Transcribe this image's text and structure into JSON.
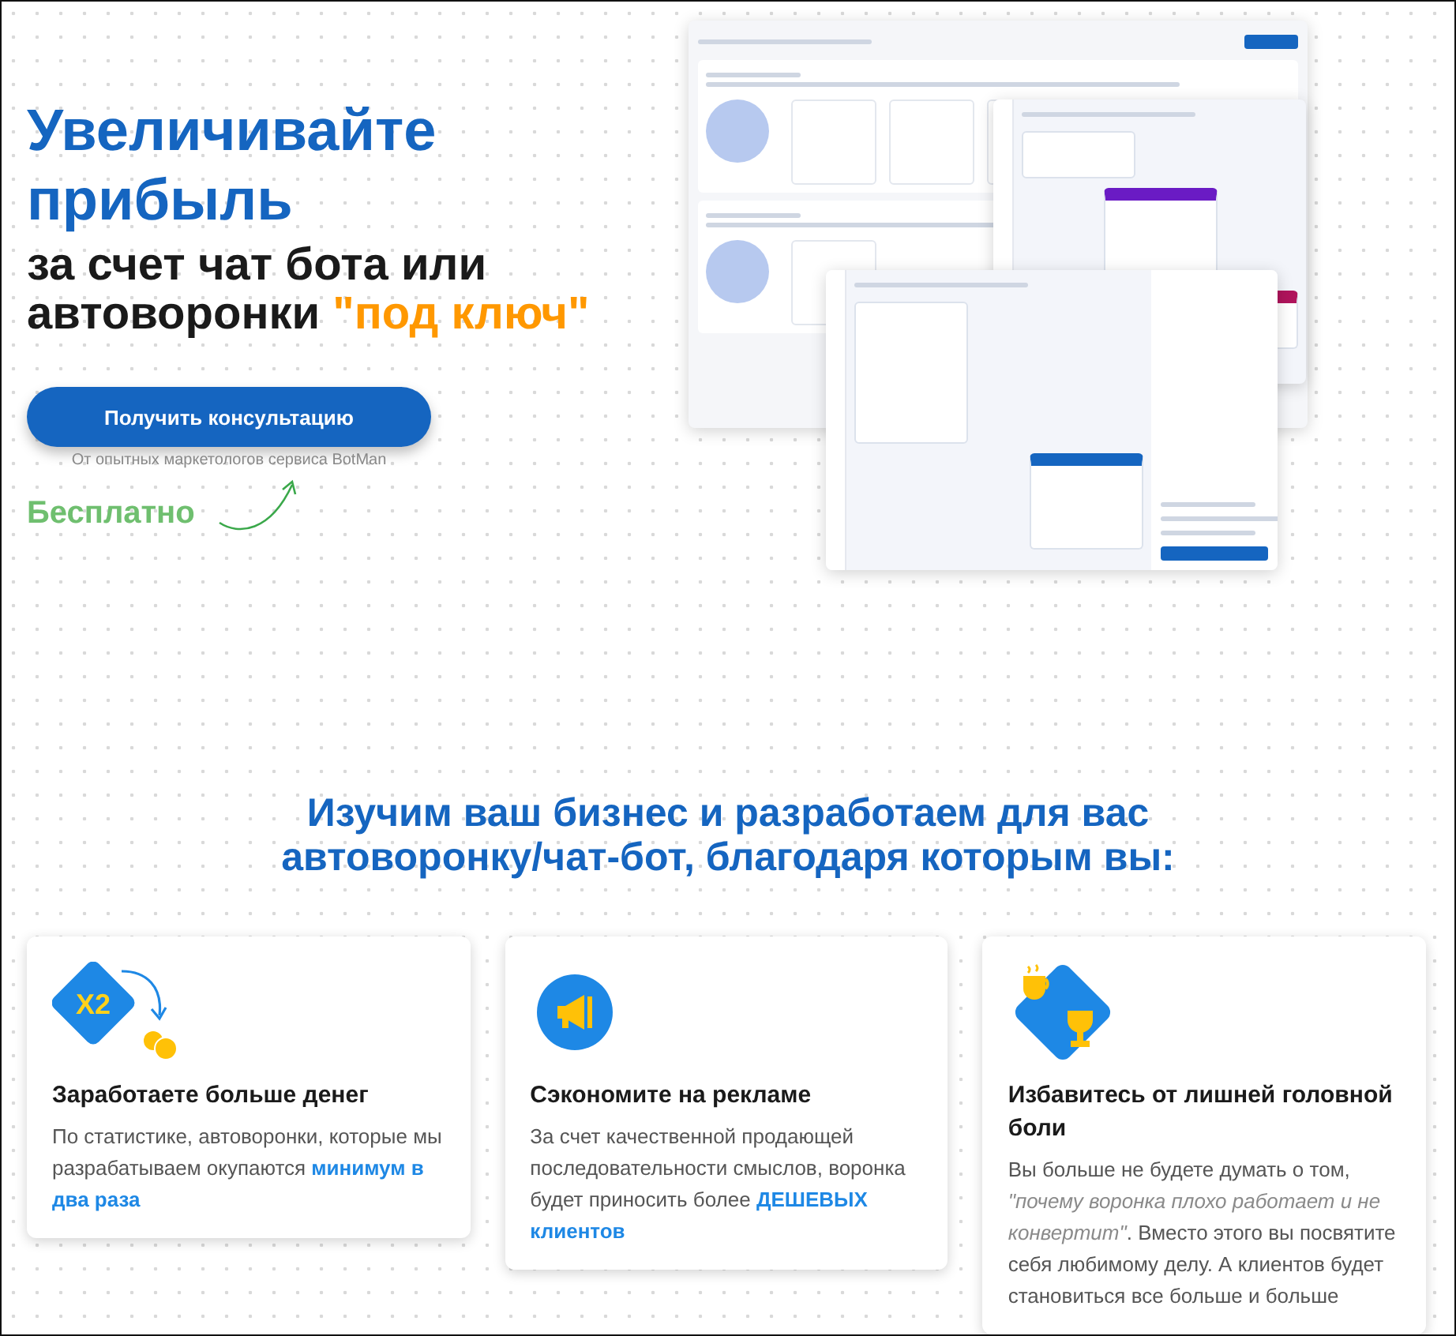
{
  "hero": {
    "title": "Увеличивайте прибыль",
    "subtitle": "за счет чат бота или автоворонки **\"под ключ\"**",
    "cta_button": "Получить консультацию",
    "cta_note": "От опытных маркетологов сервиса BotMan",
    "free_label": "Бесплатно"
  },
  "benefits": {
    "heading": "Изучим ваш бизнес и разработаем для вас автоворонку/чат-бот, благодаря которым вы:",
    "cards": [
      {
        "kind": "x2",
        "badge": "X2",
        "title": "Заработаете больше денег",
        "text": "По статистике, автоворонки, которые мы разрабатываем окупаются **минимум в два раза**"
      },
      {
        "kind": "megaphone",
        "title": "Сэкономите на рекламе",
        "text": "За счет качественной продающей последовательности смыслов, воронка будет приносить более **ДЕШЕВЫХ клиентов**"
      },
      {
        "kind": "trophy",
        "title": "Избавитесь от лишней головной боли",
        "text": "Вы больше не будете думать о том, *\"почему воронка плохо работает и не конвертит\"*. Вместо этого вы посвятите себя любимому делу. А клиентов будет становиться все больше и больше"
      }
    ]
  }
}
